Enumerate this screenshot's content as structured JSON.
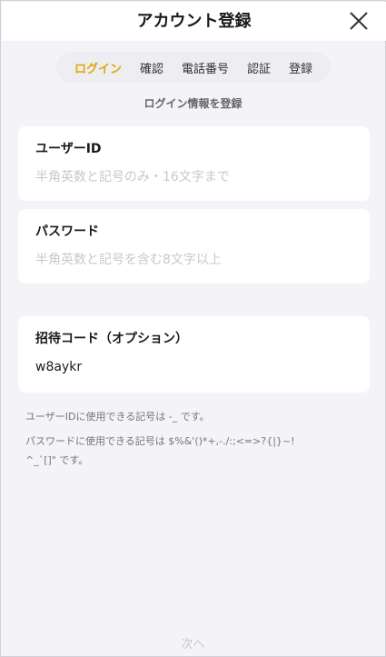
{
  "header": {
    "title": "アカウント登録"
  },
  "steps": [
    "ログイン",
    "確認",
    "電話番号",
    "認証",
    "登録"
  ],
  "subtitle": "ログイン情報を登録",
  "fields": {
    "user_id": {
      "label": "ユーザーID",
      "placeholder": "半角英数と記号のみ・16文字まで",
      "value": ""
    },
    "password": {
      "label": "パスワード",
      "placeholder": "半角英数と記号を含む8文字以上",
      "value": ""
    },
    "invite_code": {
      "label": "招待コード（オプション）",
      "value": "w8aykr"
    }
  },
  "notes": {
    "user_id_symbols": "ユーザーIDに使用できる記号は -_ です。",
    "password_symbols_line1": "パスワードに使用できる記号は $%&'()*+,-./:;<=>?{|}~!",
    "password_symbols_line2": "^_`[]\" です。"
  },
  "next_button": "次へ",
  "colors": {
    "active_step": "#e0a800",
    "background": "#f4f4f8",
    "card": "#ffffff"
  }
}
